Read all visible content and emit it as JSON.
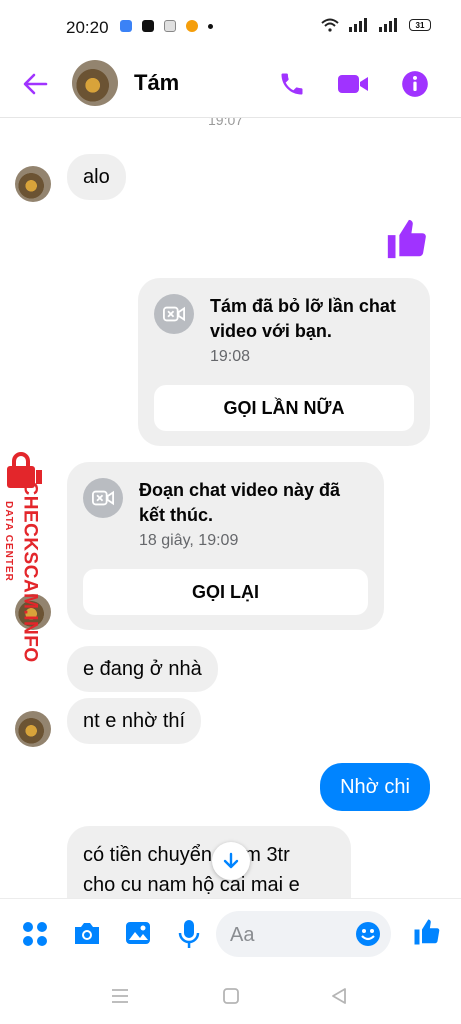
{
  "status": {
    "time": "20:20",
    "battery": "31"
  },
  "header": {
    "contact_name": "Tám"
  },
  "chat": {
    "top_time": "19:07",
    "msg_alo": "alo",
    "missed_call": {
      "title_line1": "Tám đã bỏ lỡ lần chat",
      "title_line2": "video với bạn.",
      "time": "19:08",
      "button": "GỌI LẦN NỮA"
    },
    "ended_call": {
      "title_line1": "Đoạn chat video này đã",
      "title_line2": "kết thúc.",
      "time": "18 giây, 19:09",
      "button": "GỌI LẠI"
    },
    "msg_home": "e đang ở nhà",
    "msg_nt": "nt e nhờ thí",
    "msg_own": "Nhờ chi",
    "msg_last_line1": "có tiền chuyển giùm 3tr",
    "msg_last_line2": "cho cu nam hộ cái mai e"
  },
  "watermark": {
    "main": "CHECKSCAM.INFO",
    "sub": "DATA CENTER"
  },
  "composer": {
    "placeholder": "Aa"
  },
  "colors": {
    "accent": "#a033ff",
    "own_bubble": "#0084ff",
    "incoming_bubble": "#efefef",
    "watermark": "#e3262b"
  },
  "icons": [
    "back-arrow-icon",
    "phone-icon",
    "video-camera-icon",
    "info-icon",
    "like-icon",
    "video-call-icon",
    "scroll-down-icon",
    "menu-dots-icon",
    "camera-icon",
    "image-icon",
    "microphone-icon",
    "emoji-icon",
    "thumbs-up-icon",
    "nav-recent-icon",
    "nav-home-icon",
    "nav-back-icon"
  ]
}
